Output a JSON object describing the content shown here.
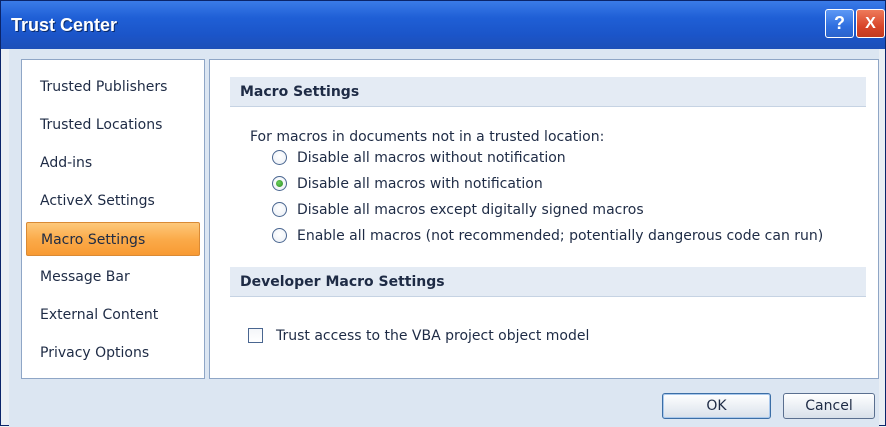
{
  "window": {
    "title": "Trust Center",
    "help_label": "?",
    "close_label": "X"
  },
  "nav": {
    "items": [
      {
        "label": "Trusted Publishers"
      },
      {
        "label": "Trusted Locations"
      },
      {
        "label": "Add-ins"
      },
      {
        "label": "ActiveX Settings"
      },
      {
        "label": "Macro Settings",
        "selected": true
      },
      {
        "label": "Message Bar"
      },
      {
        "label": "External Content"
      },
      {
        "label": "Privacy Options"
      }
    ]
  },
  "macro_settings": {
    "header": "Macro Settings",
    "intro": "For macros in documents not in a trusted location:",
    "options": [
      {
        "label": "Disable all macros without notification",
        "checked": false
      },
      {
        "label": "Disable all macros with notification",
        "checked": true
      },
      {
        "label": "Disable all macros except digitally signed macros",
        "checked": false
      },
      {
        "label": "Enable all macros (not recommended; potentially dangerous code can run)",
        "checked": false
      }
    ]
  },
  "developer_settings": {
    "header": "Developer Macro Settings",
    "vba_label": "Trust access to the VBA project object model",
    "vba_checked": false
  },
  "footer": {
    "ok_label": "OK",
    "cancel_label": "Cancel"
  },
  "colors": {
    "title_bar": "#1f5fd6",
    "selected_nav": "#fbab4a",
    "section_header": "#e4ebf4"
  }
}
